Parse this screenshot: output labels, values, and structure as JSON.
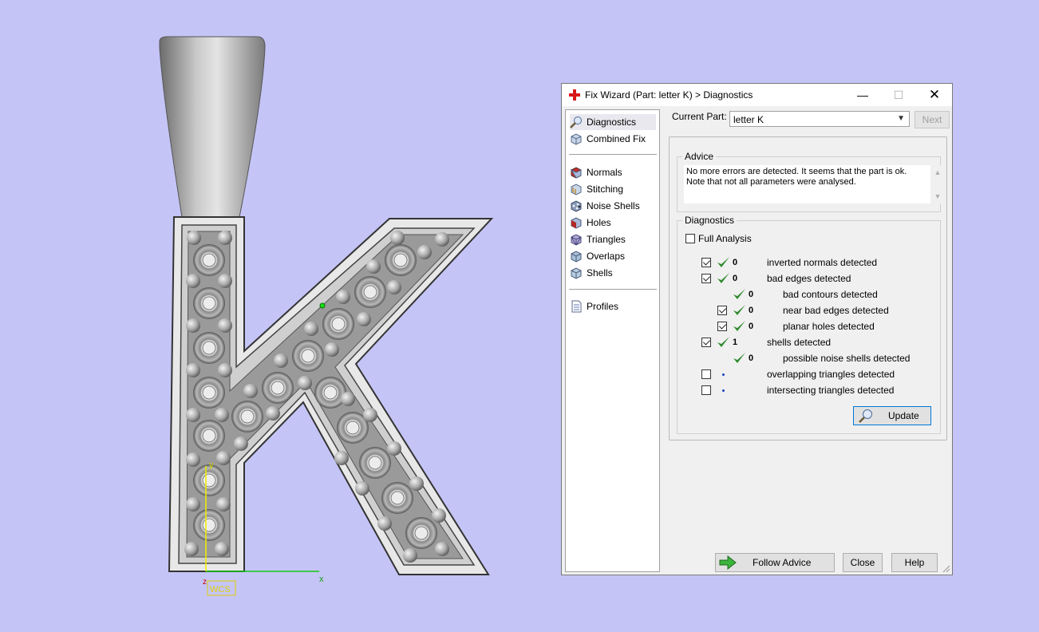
{
  "viewport": {
    "axis_x_label": "x",
    "axis_y_label": "y",
    "axis_z_label": "z",
    "wcs_label": "WCS"
  },
  "dialog": {
    "title": "Fix Wizard (Part: letter K) > Diagnostics",
    "title_icon": "red-cross-icon",
    "minimize": "—",
    "maximize": "☐",
    "close": "✕"
  },
  "nav": {
    "items": [
      {
        "label": "Diagnostics",
        "icon": "magnifier-icon"
      },
      {
        "label": "Combined Fix",
        "icon": "cube-icon"
      },
      {
        "label": "Normals",
        "icon": "normals-cube-icon"
      },
      {
        "label": "Stitching",
        "icon": "stitching-cube-icon"
      },
      {
        "label": "Noise Shells",
        "icon": "noise-shells-icon"
      },
      {
        "label": "Holes",
        "icon": "holes-cube-icon"
      },
      {
        "label": "Triangles",
        "icon": "triangles-cube-icon"
      },
      {
        "label": "Overlaps",
        "icon": "overlaps-cube-icon"
      },
      {
        "label": "Shells",
        "icon": "shells-cube-icon"
      },
      {
        "label": "Profiles",
        "icon": "document-icon"
      }
    ]
  },
  "current_part": {
    "label": "Current Part:",
    "value": "letter K",
    "next": "Next"
  },
  "advice": {
    "label": "Advice",
    "line1": "No more errors are detected. It seems that the part is ok.",
    "line2": "Note that not all parameters were analysed."
  },
  "diagnostics": {
    "label": "Diagnostics",
    "full_analysis": "Full Analysis",
    "full_analysis_checked": false,
    "rows": [
      {
        "checked": true,
        "status": "ok",
        "count": "0",
        "text": "inverted normals detected"
      },
      {
        "checked": true,
        "status": "ok",
        "count": "0",
        "text": "bad edges detected"
      },
      {
        "status": "ok",
        "count": "0",
        "text": "bad contours detected"
      },
      {
        "checked": true,
        "status": "ok",
        "count": "0",
        "text": "near bad edges detected"
      },
      {
        "checked": true,
        "status": "ok",
        "count": "0",
        "text": "planar holes detected"
      },
      {
        "checked": true,
        "status": "ok",
        "count": "1",
        "text": "shells detected"
      },
      {
        "status": "ok",
        "count": "0",
        "text": "possible noise shells detected"
      },
      {
        "checked": false,
        "status": "pending",
        "text": "overlapping triangles detected"
      },
      {
        "checked": false,
        "status": "pending",
        "text": "intersecting triangles detected"
      }
    ],
    "update": "Update"
  },
  "buttons": {
    "follow_advice": "Follow Advice",
    "close": "Close",
    "help": "Help"
  },
  "colors": {
    "background": "#c4c4f6",
    "check_green": "#2e8b2e",
    "accent_blue": "#0078d7"
  }
}
